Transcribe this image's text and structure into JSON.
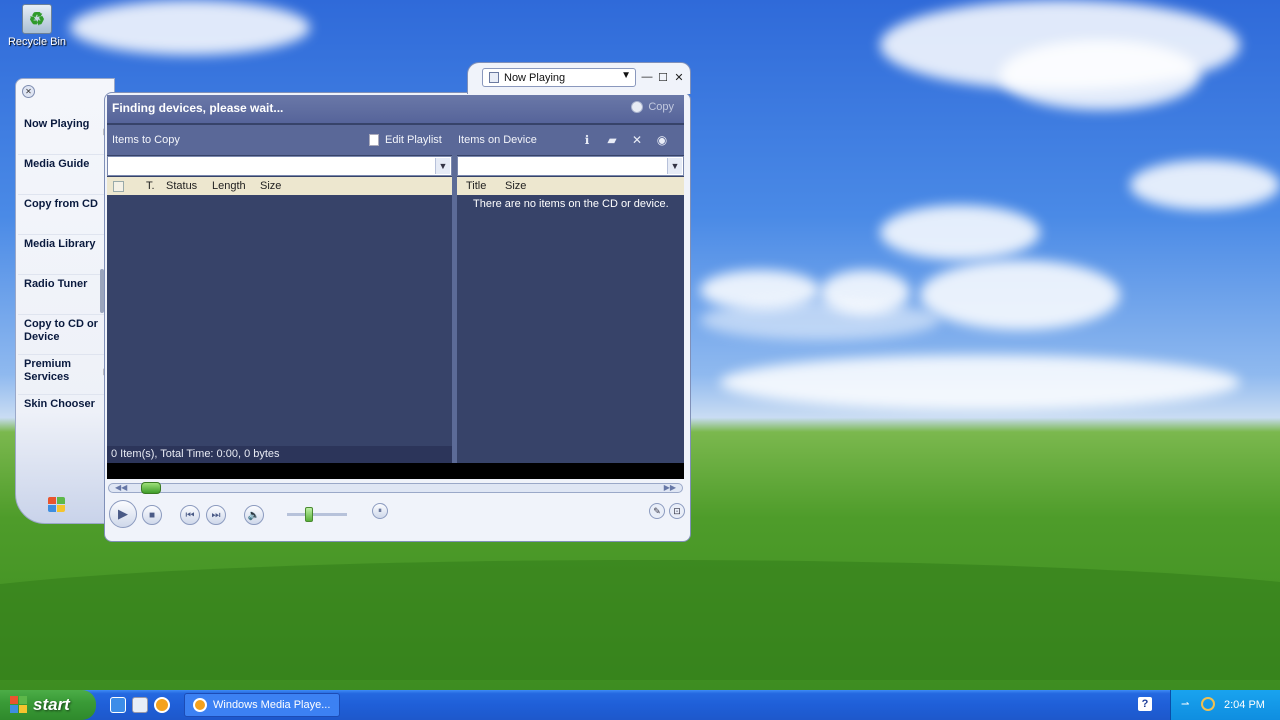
{
  "desktop": {
    "recycle_bin_label": "Recycle Bin"
  },
  "taskpane": {
    "items": [
      {
        "label": "Now Playing",
        "has_arrow": true
      },
      {
        "label": "Media Guide",
        "has_arrow": false
      },
      {
        "label": "Copy from CD",
        "has_arrow": false
      },
      {
        "label": "Media Library",
        "has_arrow": false
      },
      {
        "label": "Radio Tuner",
        "has_arrow": false
      },
      {
        "label": "Copy to CD or Device",
        "has_arrow": false
      },
      {
        "label": "Premium Services",
        "has_arrow": true
      },
      {
        "label": "Skin Chooser",
        "has_arrow": false
      }
    ]
  },
  "window": {
    "now_playing_selector": "Now Playing",
    "status_text": "Finding devices, please wait...",
    "copy_button": "Copy",
    "items_to_copy_label": "Items to Copy",
    "edit_playlist_label": "Edit Playlist",
    "items_on_device_label": "Items on Device",
    "left_columns": [
      "T.",
      "Status",
      "Length",
      "Size"
    ],
    "right_columns": [
      "Title",
      "Size"
    ],
    "empty_message": "There are no items on the CD or device.",
    "item_count": "0 Item(s), Total Time: 0:00, 0 bytes"
  },
  "taskbar": {
    "start_label": "start",
    "task_button_label": "Windows Media Playe...",
    "clock": "2:04 PM",
    "help_glyph": "?"
  },
  "colors": {
    "content_bg": "#374369",
    "status_bar": "#6a78a8",
    "taskbar": "#2468e0",
    "start_green": "#3a9b37"
  }
}
